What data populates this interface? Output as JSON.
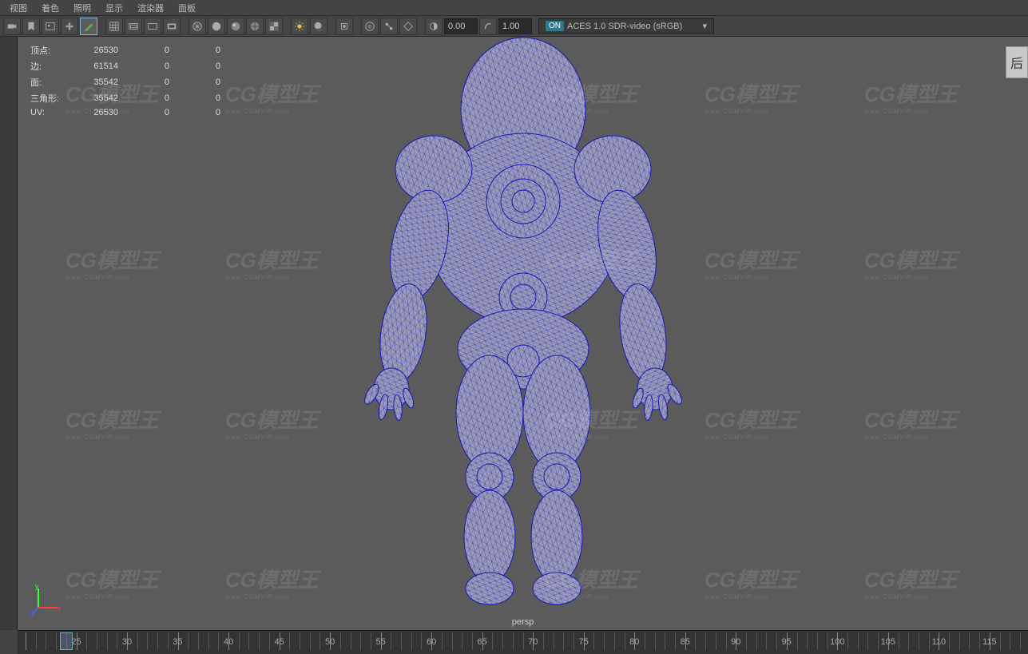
{
  "panel_menu": {
    "items": [
      "视图",
      "着色",
      "照明",
      "显示",
      "渲染器",
      "面板"
    ]
  },
  "toolbar": {
    "val1": "0.00",
    "val2": "1.00",
    "color_space_on": "ON",
    "color_space": "ACES 1.0 SDR-video (sRGB)"
  },
  "hud": {
    "rows": [
      {
        "label": "顶点:",
        "a": "26530",
        "b": "0",
        "c": "0"
      },
      {
        "label": "边:",
        "a": "61514",
        "b": "0",
        "c": "0"
      },
      {
        "label": "面:",
        "a": "35542",
        "b": "0",
        "c": "0"
      },
      {
        "label": "三角形:",
        "a": "35542",
        "b": "0",
        "c": "0"
      },
      {
        "label": "UV:",
        "a": "26530",
        "b": "0",
        "c": "0"
      }
    ]
  },
  "view_label": "persp",
  "axis": {
    "x": "x",
    "y": "y",
    "z": "z"
  },
  "side_button": "后",
  "watermark": {
    "brand": "CG模型王",
    "url": "www.CGMXW.com"
  },
  "timeline": {
    "start": 20,
    "end": 118,
    "current": 24,
    "majors": [
      25,
      30,
      35,
      40,
      45,
      50,
      55,
      60,
      65,
      70,
      75,
      80,
      85,
      90,
      95,
      100,
      105,
      110,
      115
    ]
  }
}
